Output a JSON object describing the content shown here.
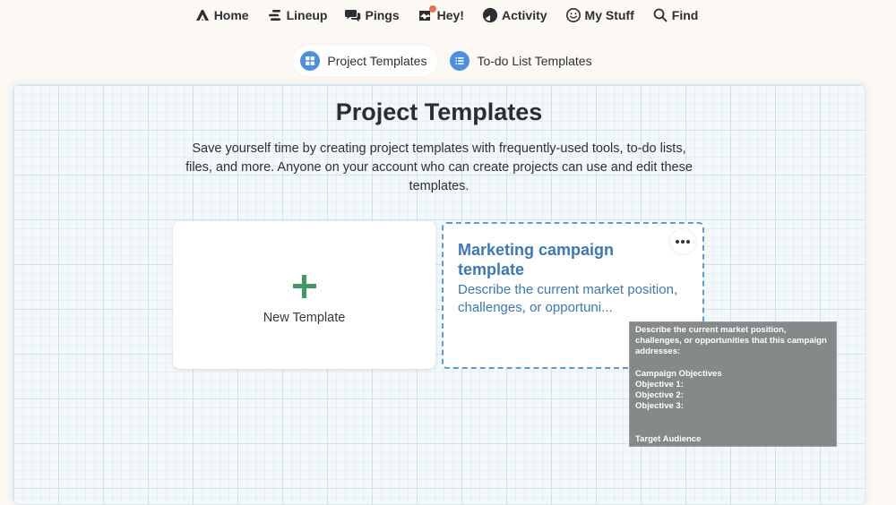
{
  "nav": {
    "items": [
      {
        "label": "Home",
        "icon": "home-icon"
      },
      {
        "label": "Lineup",
        "icon": "lineup-icon"
      },
      {
        "label": "Pings",
        "icon": "pings-icon"
      },
      {
        "label": "Hey!",
        "icon": "hey-inbox-icon",
        "badge_color": "#ee6f4f"
      },
      {
        "label": "Activity",
        "icon": "activity-icon"
      },
      {
        "label": "My Stuff",
        "icon": "smiley-icon"
      },
      {
        "label": "Find",
        "icon": "search-icon"
      }
    ]
  },
  "tabs": [
    {
      "label": "Project Templates",
      "icon": "grid-icon",
      "active": true
    },
    {
      "label": "To-do List Templates",
      "icon": "list-icon",
      "active": false
    }
  ],
  "page": {
    "title": "Project Templates",
    "description": "Save yourself time by creating project templates with frequently-used tools, to-do lists, files, and more. Anyone on your account who can create projects can use and edit these templates."
  },
  "cards": {
    "new_template": {
      "label": "New Template",
      "icon": "plus-icon",
      "icon_color": "#3c9a62"
    },
    "templates": [
      {
        "title": "Marketing campaign template",
        "excerpt": "Describe the current market position, challenges, or opportuni...",
        "more_icon": "ellipsis-icon"
      }
    ]
  },
  "tooltip": {
    "text": "Describe the current market position, challenges, or opportunities that this campaign addresses:\n\nCampaign Objectives\nObjective 1:\nObjective 2:\nObjective 3:\n\n\nTarget Audience"
  },
  "colors": {
    "accent_blue": "#3a78b9",
    "tab_icon_blue": "#4a90e2",
    "plus_green": "#3c9a62",
    "badge_orange": "#ee6f4f"
  }
}
